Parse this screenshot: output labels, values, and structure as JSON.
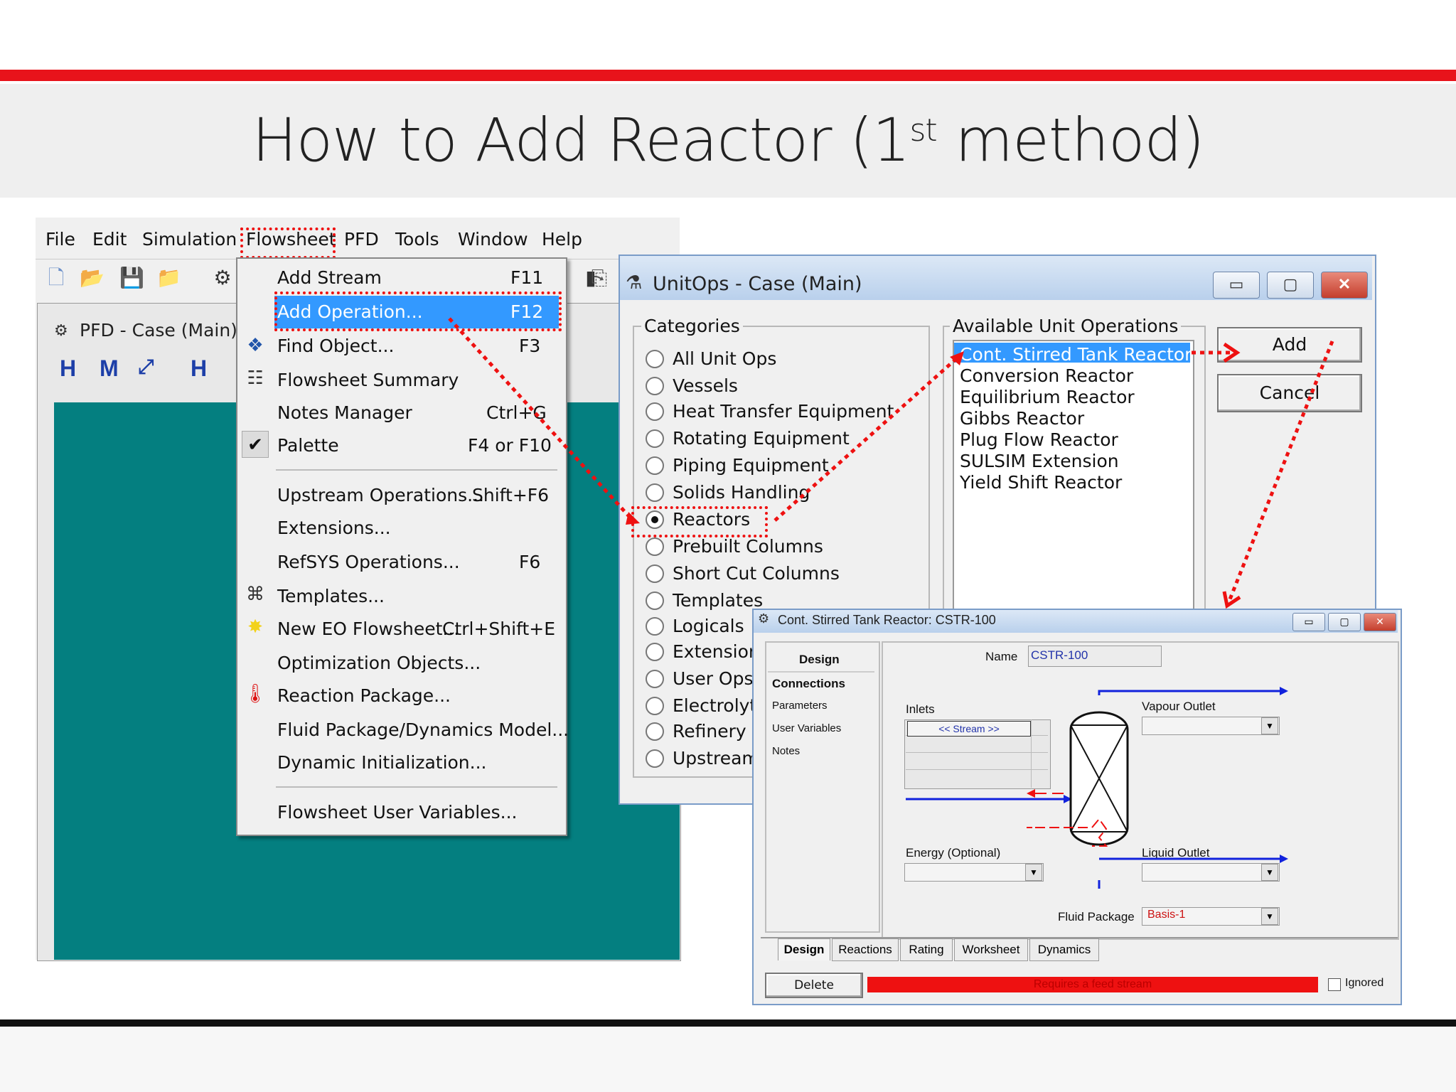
{
  "slide": {
    "title": "How to Add Reactor (1",
    "title_sup": "st",
    "title_end": " method)",
    "accent_color": "#e8131b"
  },
  "menubar": [
    "File",
    "Edit",
    "Simulation",
    "Flowsheet",
    "PFD",
    "Tools",
    "Window",
    "Help"
  ],
  "pfd_window": {
    "title": "PFD - Case (Main)",
    "background": "#047f80"
  },
  "flowsheet_menu": {
    "items": [
      {
        "label": "Add Stream",
        "key": "F11",
        "icon": ""
      },
      {
        "label": "Add Operation...",
        "key": "F12",
        "icon": "",
        "highlighted": true
      },
      {
        "label": "Find Object...",
        "key": "F3",
        "icon": "find-object-icon"
      },
      {
        "label": "Flowsheet Summary",
        "key": "",
        "icon": "flowsheet-summary-icon"
      },
      {
        "label": "Notes Manager",
        "key": "Ctrl+G",
        "icon": ""
      },
      {
        "label": "Palette",
        "key": "F4 or F10",
        "icon": "checkmark-icon"
      },
      {
        "label": "Upstream Operations...",
        "key": "Shift+F6",
        "icon": ""
      },
      {
        "label": "Extensions...",
        "key": "",
        "icon": ""
      },
      {
        "label": "RefSYS Operations...",
        "key": "F6",
        "icon": ""
      },
      {
        "label": "Templates...",
        "key": "",
        "icon": "templates-icon"
      },
      {
        "label": "New EO Flowsheet...",
        "key": "Ctrl+Shift+E",
        "icon": "eo-flowsheet-icon"
      },
      {
        "label": "Optimization Objects...",
        "key": "",
        "icon": ""
      },
      {
        "label": "Reaction Package...",
        "key": "",
        "icon": "reaction-package-icon"
      },
      {
        "label": "Fluid Package/Dynamics Model...",
        "key": "",
        "icon": ""
      },
      {
        "label": "Dynamic Initialization...",
        "key": "",
        "icon": ""
      },
      {
        "label": "Flowsheet User Variables...",
        "key": "",
        "icon": ""
      }
    ]
  },
  "unitops": {
    "title": "UnitOps - Case (Main)",
    "categories_label": "Categories",
    "categories": [
      "All Unit Ops",
      "Vessels",
      "Heat Transfer Equipment",
      "Rotating Equipment",
      "Piping Equipment",
      "Solids Handling",
      "Reactors",
      "Prebuilt Columns",
      "Short Cut Columns",
      "Templates",
      "Logicals",
      "Extensions",
      "User Ops",
      "Electrolyte",
      "Refinery O",
      "Upstream"
    ],
    "selected_category": "Reactors",
    "available_label": "Available Unit Operations",
    "available": [
      "Cont. Stirred Tank Reactor",
      "Conversion Reactor",
      "Equilibrium Reactor",
      "Gibbs Reactor",
      "Plug Flow Reactor",
      "SULSIM Extension",
      "Yield Shift Reactor"
    ],
    "selected_available": "Cont. Stirred Tank Reactor",
    "add_label": "Add",
    "cancel_label": "Cancel"
  },
  "cstr": {
    "title": "Cont. Stirred Tank Reactor: CSTR-100",
    "nav_header": "Design",
    "nav": [
      "Connections",
      "Parameters",
      "User Variables",
      "Notes"
    ],
    "name_label": "Name",
    "name_value": "CSTR-100",
    "inlets_label": "Inlets",
    "inlet_stream": "<< Stream >>",
    "vapour_label": "Vapour Outlet",
    "liquid_label": "Liquid Outlet",
    "energy_label": "Energy (Optional)",
    "fluid_package_label": "Fluid Package",
    "fluid_package_value": "Basis-1",
    "tabs": [
      "Design",
      "Reactions",
      "Rating",
      "Worksheet",
      "Dynamics"
    ],
    "delete_label": "Delete",
    "status": "Requires a feed stream",
    "ignored_label": "Ignored"
  }
}
